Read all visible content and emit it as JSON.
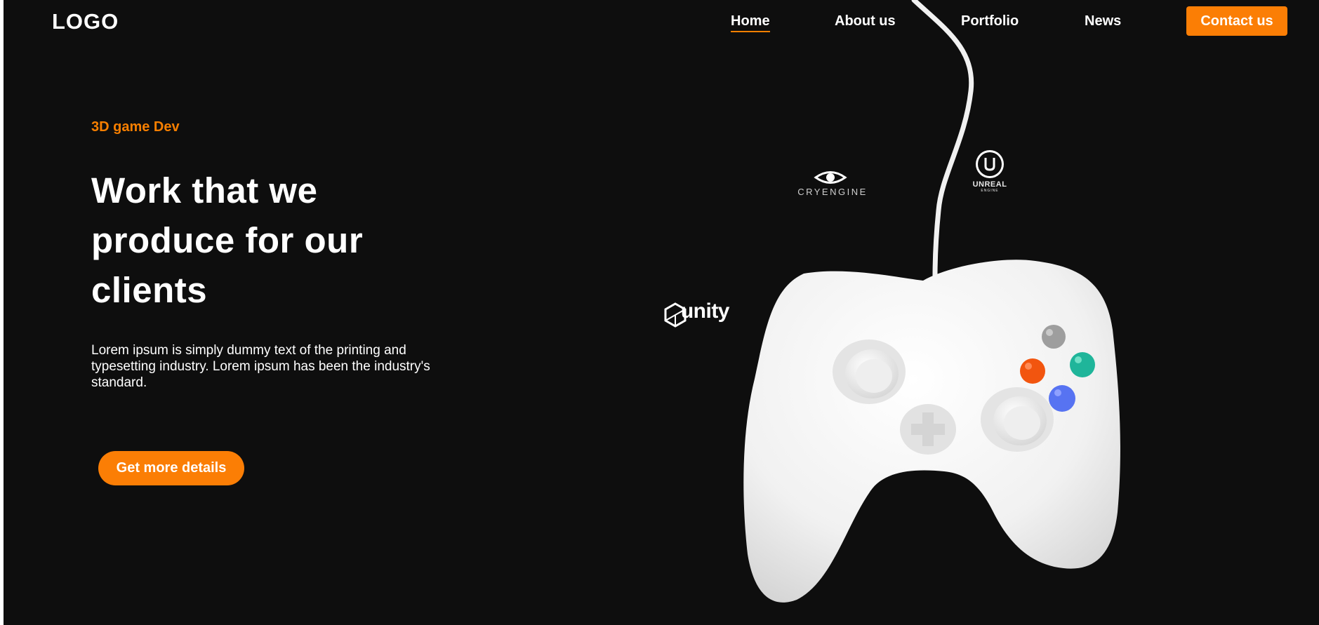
{
  "header": {
    "logo": "LOGO",
    "nav": [
      {
        "label": "Home",
        "active": true
      },
      {
        "label": "About us",
        "active": false
      },
      {
        "label": "Portfolio",
        "active": false
      },
      {
        "label": "News",
        "active": false
      }
    ],
    "contact_label": "Contact us"
  },
  "hero": {
    "eyebrow": "3D game Dev",
    "title_lines": [
      "Work that we",
      "produce for our",
      "clients"
    ],
    "description_lines": [
      "Lorem ipsum is simply dummy text of the printing and",
      "typesetting industry. Lorem ipsum has been the industry's",
      "standard."
    ],
    "cta_label": "Get more details"
  },
  "engines": {
    "cryengine": "CRYENGINE",
    "unreal": "UNREAL",
    "unreal_sub": "ENGINE",
    "unity": "unity"
  },
  "colors": {
    "accent": "#fb7e05",
    "background": "#0e0e0e",
    "button_gray": "#9e9e9e",
    "button_teal": "#1fb59a",
    "button_orange": "#f2550f",
    "button_blue": "#5773f2"
  },
  "icons": [
    "controller-image",
    "cryengine-eye-icon",
    "unreal-logo-icon",
    "unity-logo-icon"
  ]
}
